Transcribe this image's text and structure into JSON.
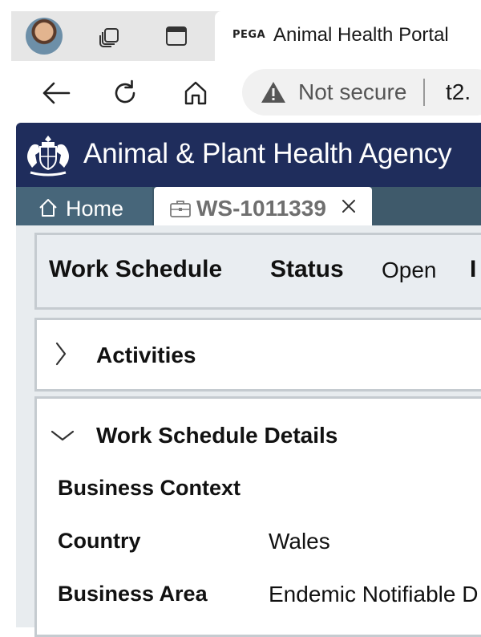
{
  "browser": {
    "tab_logo": "PEGA",
    "tab_title": "Animal Health Portal",
    "security_label": "Not secure",
    "url": "t2."
  },
  "app": {
    "agency_name": "Animal & Plant Health Agency",
    "home_tab_label": "Home",
    "case_tab_label": "WS-1011339"
  },
  "summary": {
    "title": "Work Schedule",
    "status_label": "Status",
    "status_value": "Open",
    "truncated_label": "I"
  },
  "sections": {
    "activities": {
      "title": "Activities",
      "expanded": false
    },
    "details": {
      "title": "Work Schedule Details",
      "expanded": true,
      "group_title": "Business Context",
      "fields": [
        {
          "label": "Country",
          "value": "Wales"
        },
        {
          "label": "Business Area",
          "value": "Endemic Notifiable D"
        }
      ]
    }
  },
  "colors": {
    "header_bg": "#1f2d5c",
    "tabbar_bg": "#3f5a6b",
    "work_area_bg": "#e8ecef"
  },
  "icons": [
    "profile-avatar",
    "tab-actions-icon",
    "vertical-tabs-icon",
    "back-arrow-icon",
    "refresh-icon",
    "home-icon",
    "warning-icon",
    "royal-crest-icon",
    "briefcase-icon",
    "close-icon",
    "chevron-right-icon",
    "chevron-down-icon"
  ]
}
